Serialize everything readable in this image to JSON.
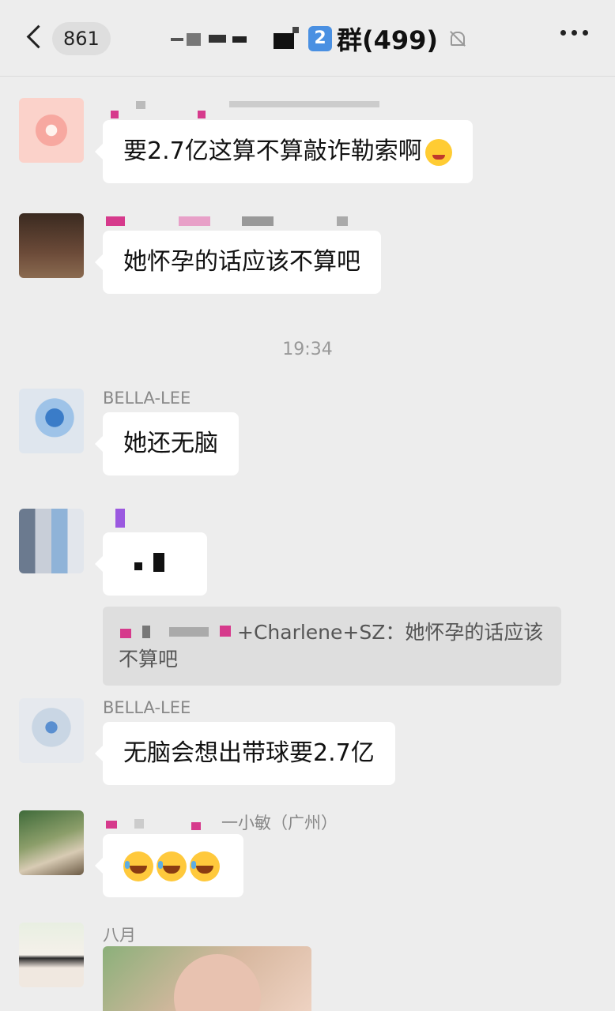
{
  "header": {
    "unread_count": "861",
    "group_badge": "2",
    "group_title": "群(499)"
  },
  "messages": [
    {
      "text": "要2.7亿这算不算敲诈勒索啊"
    },
    {
      "text": "她怀孕的话应该不算吧"
    },
    {
      "type": "timestamp",
      "text": "19:34"
    },
    {
      "sender": "BELLA-LEE",
      "text": "她还无脑"
    },
    {
      "quote_sender_suffix": "+Charlene+SZ：",
      "quote_text": "她怀孕的话应该不算吧"
    },
    {
      "sender": "BELLA-LEE",
      "text": "无脑会想出带球要2.7亿"
    },
    {
      "sender_suffix": "一小敏（广州）"
    },
    {
      "sender": "八月"
    }
  ],
  "icons": {
    "back": "chevron-left-icon",
    "mute": "mute-bell-icon",
    "more": "more-dots-icon"
  }
}
